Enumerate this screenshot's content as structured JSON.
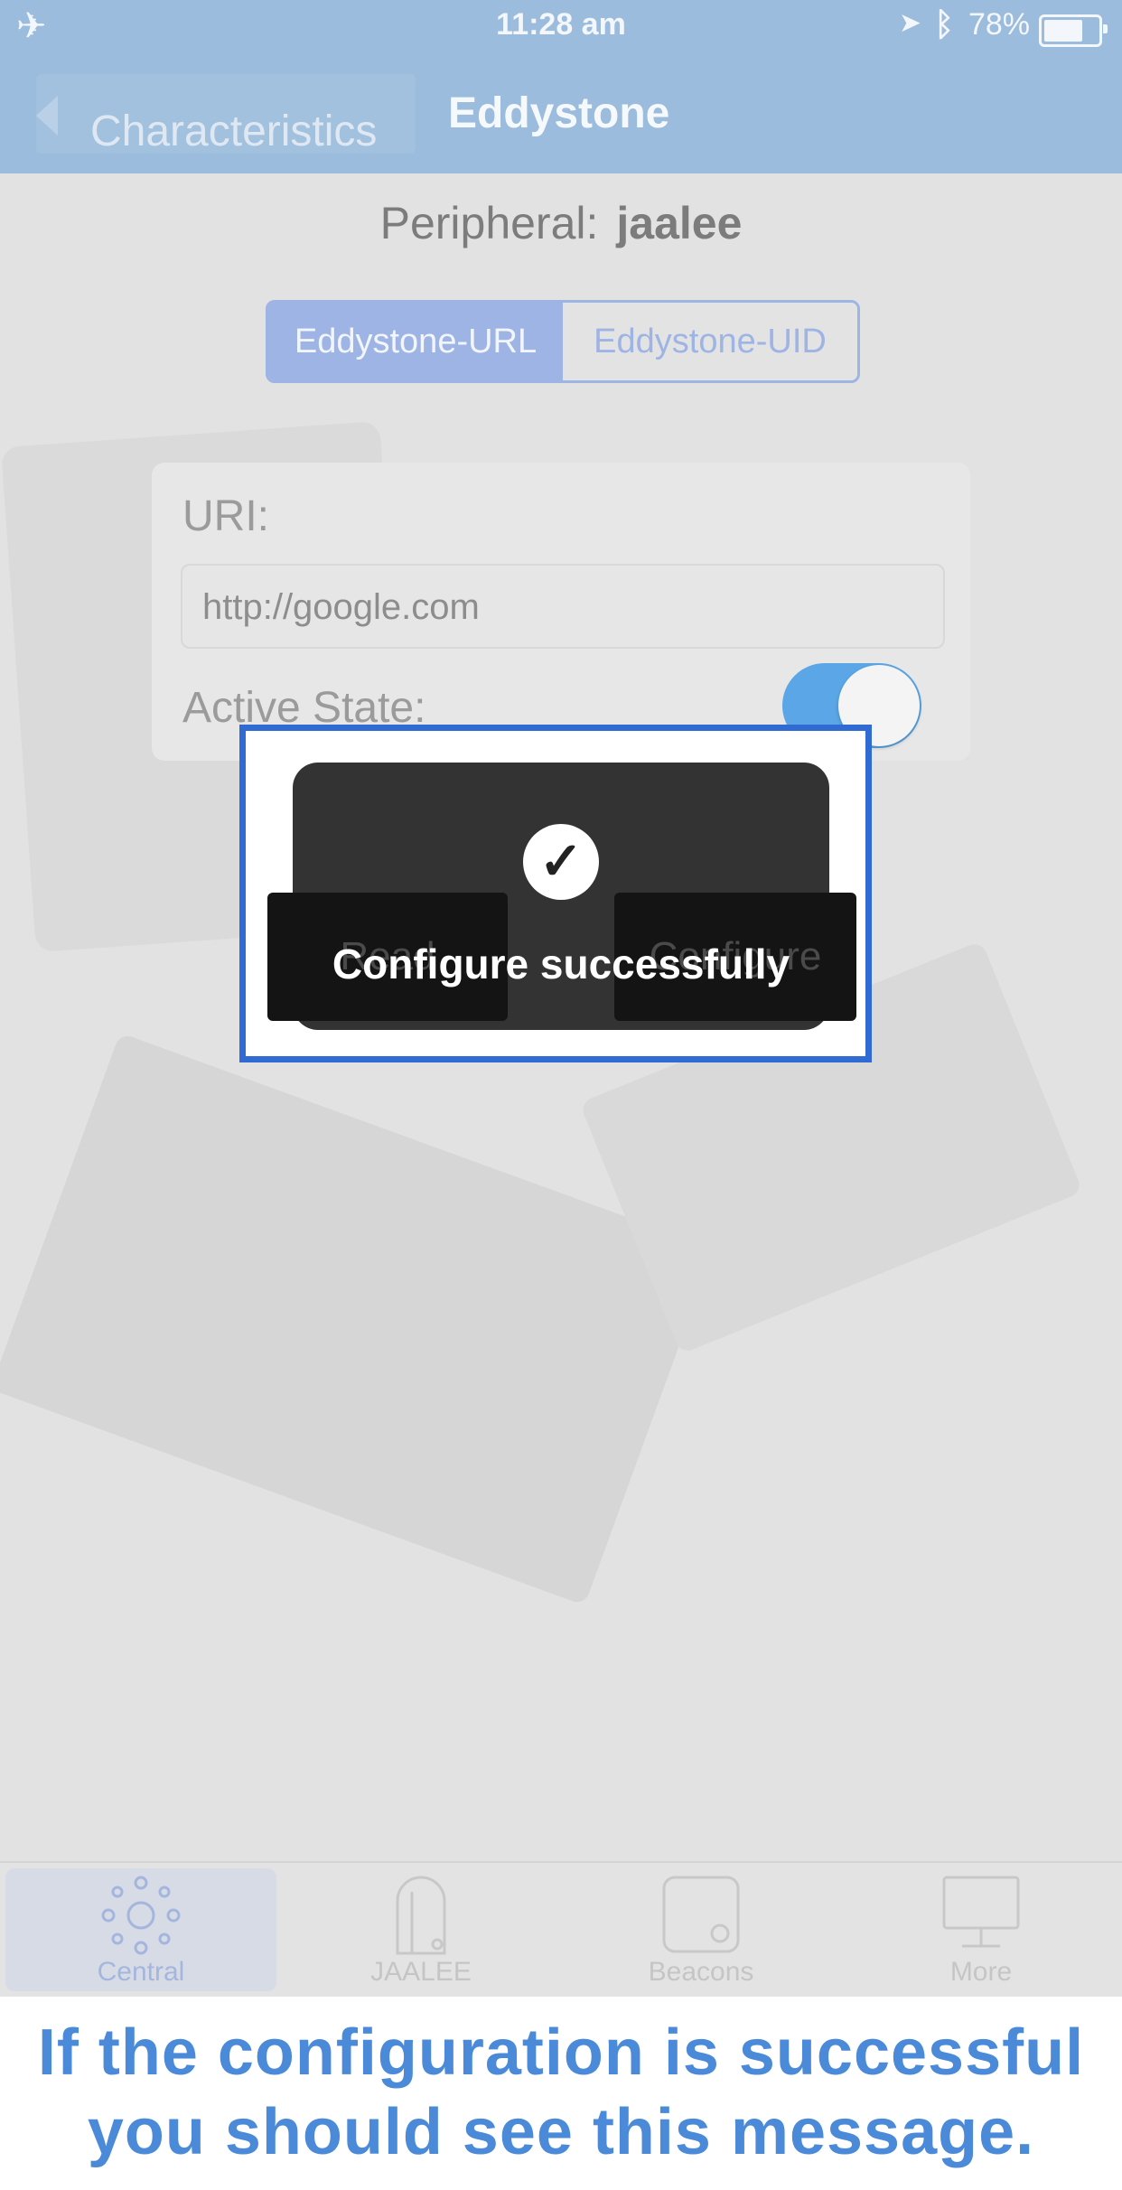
{
  "status_bar": {
    "time": "11:28 am",
    "battery": "78%"
  },
  "nav": {
    "back_label": "Characteristics",
    "title": "Eddystone"
  },
  "peripheral": {
    "label": "Peripheral:",
    "name": "jaalee"
  },
  "segments": [
    {
      "label": "Eddystone-URL",
      "selected": true
    },
    {
      "label": "Eddystone-UID",
      "selected": false
    }
  ],
  "form": {
    "uri_label": "URI:",
    "uri_value": "http://google.com",
    "active_state_label": "Active State:",
    "active_state_on": true
  },
  "buttons": {
    "read": "Read",
    "configure": "Configure"
  },
  "toast": {
    "message": "Configure successfully",
    "icon": "checkmark-icon"
  },
  "tabs": [
    {
      "label": "Central",
      "icon": "central-icon",
      "active": true
    },
    {
      "label": "JAALEE",
      "icon": "jaalee-icon",
      "active": false
    },
    {
      "label": "Beacons",
      "icon": "beacons-icon",
      "active": false
    },
    {
      "label": "More",
      "icon": "monitor-icon",
      "active": false
    }
  ],
  "caption": {
    "line1": "If the configuration is successful",
    "line2": "you should see this message."
  },
  "colors": {
    "nav": "#9bbcdc",
    "segment": "#9db4e4",
    "highlight": "#2f6bd2",
    "caption": "#4a8ad8"
  }
}
